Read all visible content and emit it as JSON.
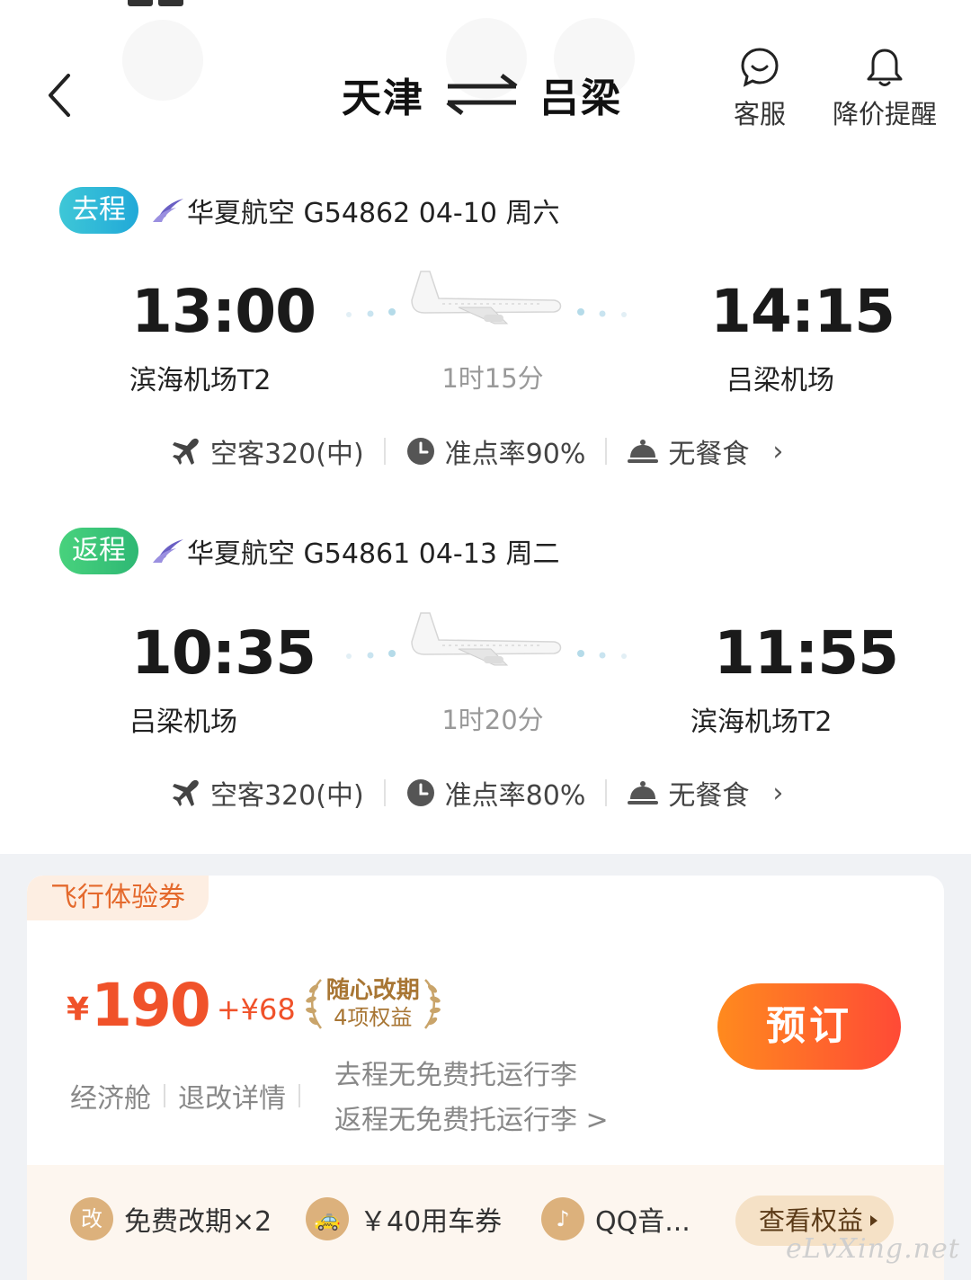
{
  "header": {
    "from_city": "天津",
    "to_city": "吕梁",
    "service_label": "客服",
    "price_alert_label": "降价提醒"
  },
  "outbound": {
    "badge": "去程",
    "info": "华夏航空 G54862  04-10 周六",
    "depart_time": "13:00",
    "depart_airport": "滨海机场T2",
    "duration": "1时15分",
    "arrive_time": "14:15",
    "arrive_airport": "吕梁机场",
    "aircraft": "空客320(中)",
    "on_time": "准点率90%",
    "meal": "无餐食"
  },
  "return": {
    "badge": "返程",
    "info": "华夏航空 G54861  04-13 周二",
    "depart_time": "10:35",
    "depart_airport": "吕梁机场",
    "duration": "1时20分",
    "arrive_time": "11:55",
    "arrive_airport": "滨海机场T2",
    "aircraft": "空客320(中)",
    "on_time": "准点率80%",
    "meal": "无餐食"
  },
  "ticket": {
    "coupon_tag": "飞行体验券",
    "currency": "¥",
    "price": "190",
    "addon": "+¥68",
    "benefit_title": "随心改期",
    "benefit_sub": "4项权益",
    "cabin": "经济舱",
    "refund_label": "退改详情",
    "baggage_out": "去程无免费托运行李",
    "baggage_back": "返程无免费托运行李 >",
    "book_label": "预订"
  },
  "perks": {
    "items": [
      {
        "icon_text": "改",
        "label": "免费改期×2"
      },
      {
        "icon_text": "🚕",
        "label": "￥40用车券"
      },
      {
        "icon_text": "♪",
        "label": "QQ音..."
      }
    ],
    "more_label": "查看权益"
  },
  "watermark": "eLvXing.net",
  "colors": {
    "accent_orange": "#f0522a",
    "outbound_badge": "#21a9d8",
    "return_badge": "#2eb874",
    "benefit_gold": "#a87634"
  }
}
